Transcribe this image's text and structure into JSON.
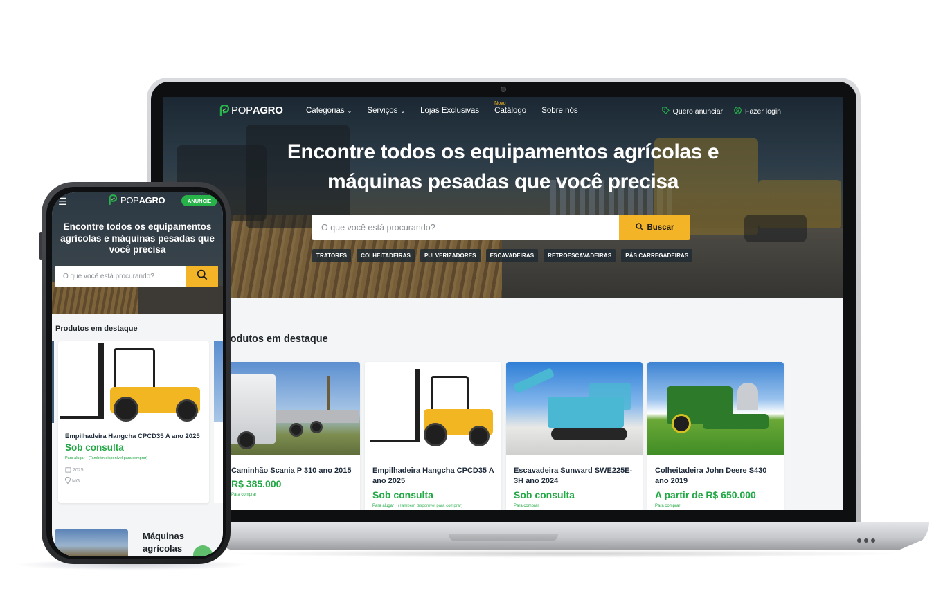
{
  "brand": {
    "logo_light": "POP",
    "logo_bold": "AGRO",
    "green": "#27b34a",
    "yellow": "#f3b427"
  },
  "desktop": {
    "nav": {
      "items": [
        {
          "label": "Categorias",
          "has_chevron": true
        },
        {
          "label": "Serviços",
          "has_chevron": true
        },
        {
          "label": "Lojas Exclusivas"
        },
        {
          "label": "Catálogo",
          "badge": "Novo"
        },
        {
          "label": "Sobre nós"
        }
      ],
      "sell_label": "Quero anunciar",
      "login_label": "Fazer login"
    },
    "hero": {
      "title_line1": "Encontre todos os equipamentos agrícolas e",
      "title_line2": "máquinas pesadas que você precisa",
      "search_placeholder": "O que você está procurando?",
      "search_button": "Buscar",
      "chips": [
        "TRATORES",
        "COLHEITADEIRAS",
        "PULVERIZADORES",
        "ESCAVADEIRAS",
        "RETROESCAVADEIRAS",
        "PÁS CARREGADEIRAS"
      ]
    },
    "featured": {
      "title": "rodutos em destaque",
      "cards": [
        {
          "name": "Caminhão Scania P 310 ano 2015",
          "price": "R$ 385.000",
          "note": "Para comprar",
          "note_extra": ""
        },
        {
          "name": "Empilhadeira Hangcha CPCD35 A ano 2025",
          "price": "Sob consulta",
          "note": "Para alugar",
          "note_extra": "(Também disponível para comprar)"
        },
        {
          "name": "Escavadeira Sunward SWE225E-3H ano 2024",
          "price": "Sob consulta",
          "note": "Para comprar",
          "note_extra": ""
        },
        {
          "name": "Colheitadeira John Deere S430 ano 2019",
          "price": "A partir de R$ 650.000",
          "note": "Para comprar",
          "note_extra": ""
        }
      ]
    }
  },
  "mobile": {
    "anuncie": "ANUNCIE",
    "hero_title": "Encontre todos os equipamentos agrícolas e máquinas pesadas que você precisa",
    "search_placeholder": "O que você está procurando?",
    "featured_title": "Produtos em destaque",
    "card": {
      "name": "Empilhadeira Hangcha CPCD35 A ano 2025",
      "price": "Sob consulta",
      "note": "Para alugar",
      "note_extra": "(Também disponível para comprar)",
      "year": "2025",
      "state": "MG"
    },
    "category_title_line1": "Máquinas",
    "category_title_line2": "agrícolas"
  }
}
